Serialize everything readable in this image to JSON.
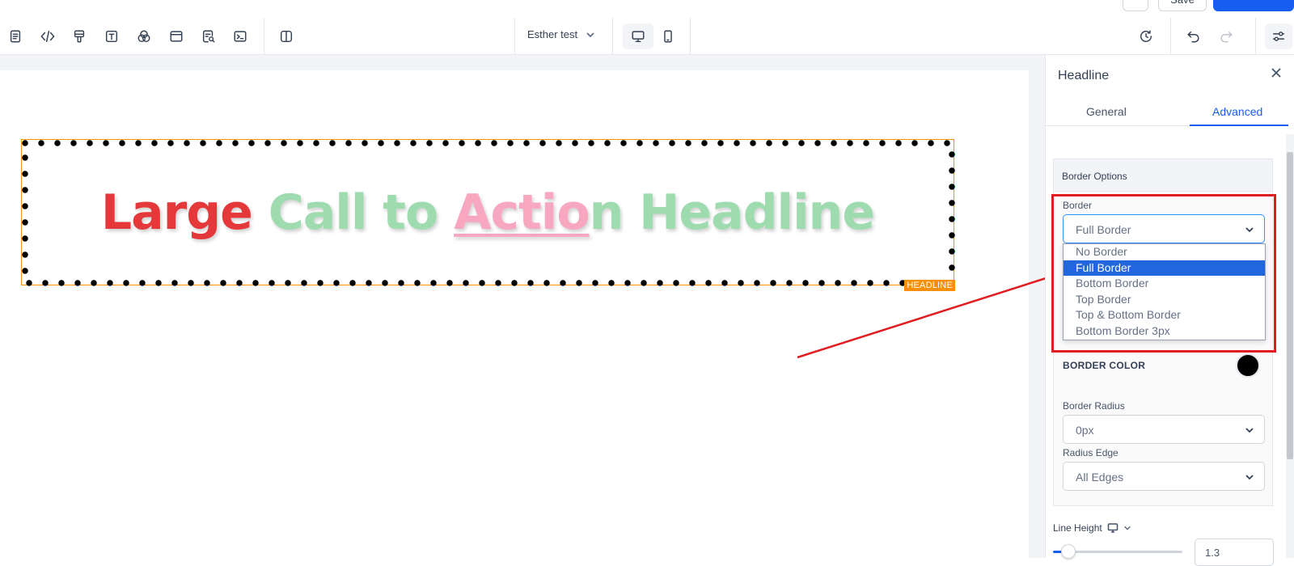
{
  "topbar": {
    "save_label": "Save"
  },
  "toolbar": {
    "page_name": "Esther test"
  },
  "canvas": {
    "headline": {
      "words": [
        {
          "text": "Large ",
          "color": "#e5383b"
        },
        {
          "text": "Call to ",
          "color": "#9edcb0"
        },
        {
          "text": "Actio",
          "color": "#f7a8c0"
        },
        {
          "text": "n Headline",
          "color": "#9edcb0"
        }
      ],
      "tag": "HEADLINE"
    }
  },
  "panel": {
    "title": "Headline",
    "tabs": [
      {
        "label": "General"
      },
      {
        "label": "Advanced"
      }
    ],
    "active_tab": "Advanced",
    "border_options": {
      "header": "Border Options",
      "border_label": "Border",
      "border_value": "Full Border",
      "border_options": [
        "No Border",
        "Full Border",
        "Bottom Border",
        "Top Border",
        "Top & Bottom Border",
        "Bottom Border 3px"
      ],
      "border_color_label": "BORDER COLOR",
      "border_color": "#000000",
      "radius_label": "Border Radius",
      "radius_value": "0px",
      "radius_edge_label": "Radius Edge",
      "radius_edge_value": "All Edges"
    },
    "line_height": {
      "label": "Line Height",
      "value": "1.3",
      "slider_fraction": 0.12
    }
  },
  "colors": {
    "accent": "#155eef",
    "annotation": "#e11d21",
    "element_outline": "#f79009"
  }
}
